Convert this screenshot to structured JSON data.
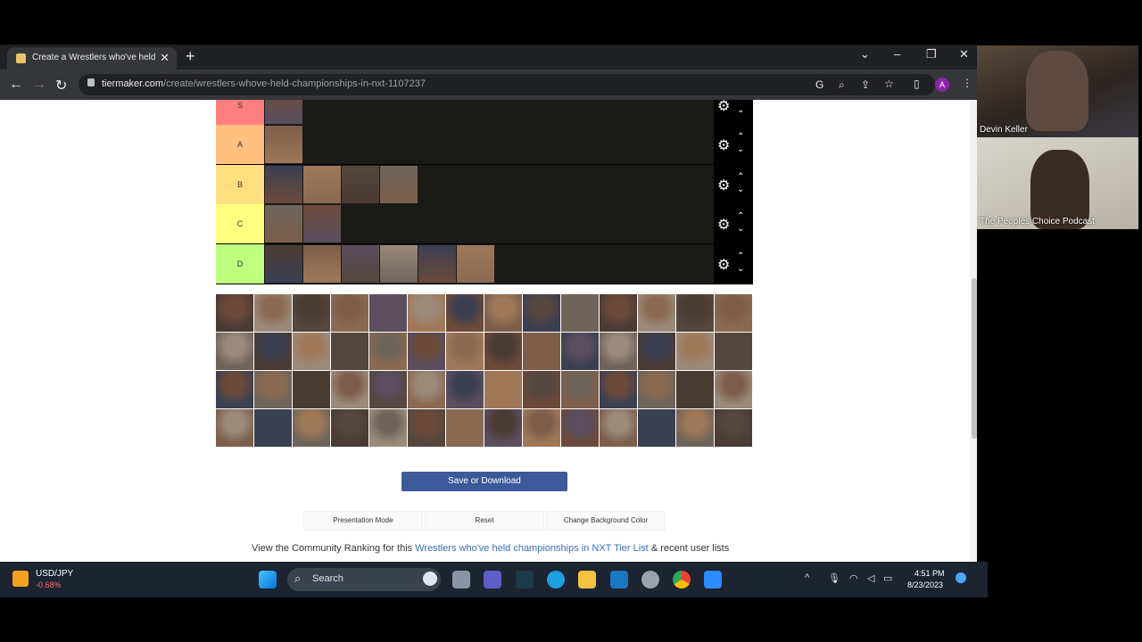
{
  "browser": {
    "tab_title": "Create a Wrestlers who've held c",
    "url_domain": "tiermaker.com",
    "url_path": "/create/wrestlers-whove-held-championships-in-nxt-1107237",
    "profile_initial": "A"
  },
  "tiers": [
    {
      "label": "S",
      "color": "#ff7f7f",
      "count": 1
    },
    {
      "label": "A",
      "color": "#ffbf7f",
      "count": 1
    },
    {
      "label": "B",
      "color": "#ffdf7f",
      "count": 4
    },
    {
      "label": "C",
      "color": "#ffff7f",
      "count": 2
    },
    {
      "label": "D",
      "color": "#bfff7f",
      "count": 6
    }
  ],
  "pool": {
    "rows": 4,
    "cols": 14
  },
  "buttons": {
    "save": "Save or Download",
    "presentation": "Presentation Mode",
    "reset": "Reset",
    "background": "Change Background Color"
  },
  "community": {
    "prefix": "View the Community Ranking for this",
    "link": "Wrestlers who've held championships in NXT Tier List",
    "suffix": "& recent user lists"
  },
  "taskbar": {
    "ticker_name": "USD/JPY",
    "ticker_change": "-0.68%",
    "search_placeholder": "Search",
    "time": "4:51 PM",
    "date": "8/23/2023"
  },
  "webcams": [
    {
      "name": "Devin Keller"
    },
    {
      "name": "The Peoples Choice Podcast"
    }
  ]
}
